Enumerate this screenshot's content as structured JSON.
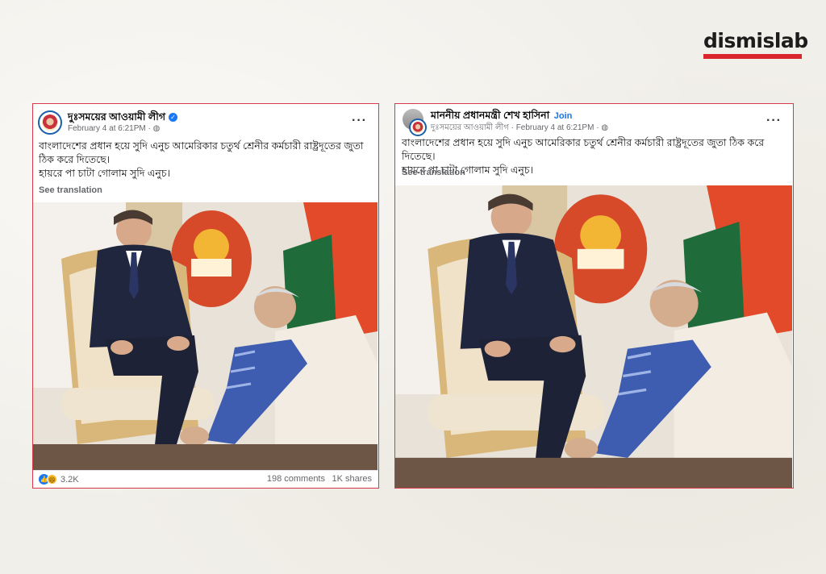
{
  "brand": {
    "name": "dismislab",
    "accent": "#d8262c"
  },
  "posts": [
    {
      "page_name": "দুঃসময়ের আওয়ামী লীগ",
      "verified": true,
      "timestamp": "February 4 at 6:21PM · ",
      "privacy_icon": "globe-icon",
      "body_line1": "বাংলাদেশের প্রধান হয়ে সুদি এনুচ আমেরিকার চতুর্থ শ্রেনীর কর্মচারী রাষ্ট্রদূতের জুতা ঠিক করে দিতেছে।",
      "body_line2": "হায়রে পা চাটা গোলাম সুদি এনুচ।",
      "see_translation": "See translation",
      "reaction_count": "3.2K",
      "comments": "198 comments",
      "shares": "1K shares"
    },
    {
      "page_name": "মাননীয় প্রধানমন্ত্রী শেখ হাসিনা",
      "join_label": "Join",
      "group_source": "দুঃসময়ের আওয়ামী লীগ",
      "timestamp": "· February 4 at 6:21PM · ",
      "privacy_icon": "globe-icon",
      "body_line1": "বাংলাদেশের প্রধান হয়ে সুদি এনুচ আমেরিকার চতুর্থ শ্রেনীর কর্মচারী রাষ্ট্রদূতের জুতা ঠিক করে দিতেছে।",
      "body_line2": "হায়রে পা চাটা গোলাম সুদি এনুচ।",
      "see_translation": "See translation"
    }
  ],
  "colors": {
    "frame": "#d63a48",
    "link_blue": "#1877f2",
    "meta_gray": "#65676b"
  }
}
